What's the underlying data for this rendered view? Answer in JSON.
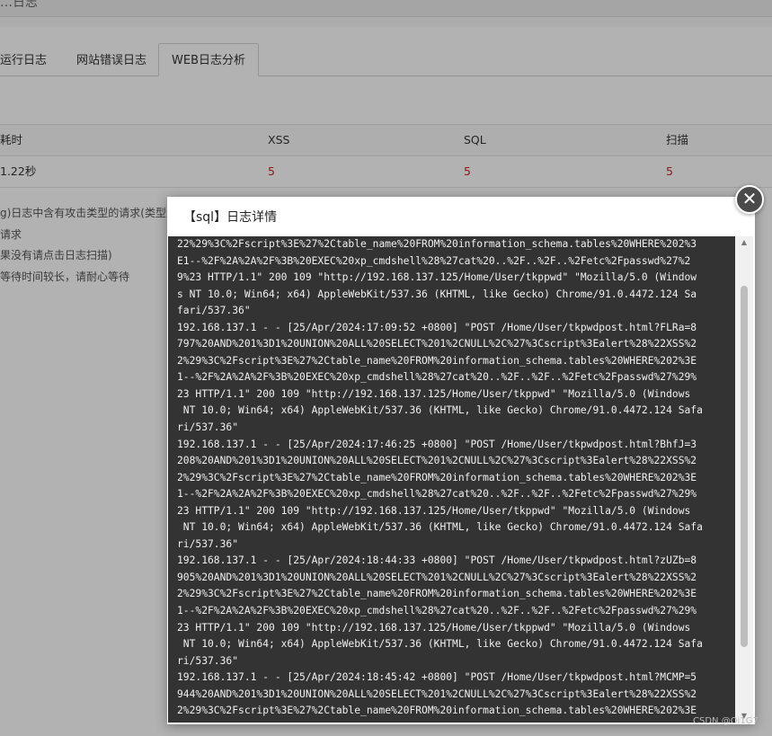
{
  "header": {
    "title_fragment": "…日志"
  },
  "tabs": [
    {
      "label": "运行日志"
    },
    {
      "label": "网站错误日志"
    },
    {
      "label": "WEB日志分析",
      "active": true
    }
  ],
  "table": {
    "columns": [
      "耗时",
      "XSS",
      "SQL",
      "扫描"
    ],
    "row": {
      "time": "1.22秒",
      "xss": "5",
      "sql": "5",
      "scan": "5"
    }
  },
  "tips": [
    "g)日志中含有攻击类型的请求(类型包",
    "请求",
    "果没有请点击日志扫描)",
    "等待时间较长，请耐心等待"
  ],
  "modal": {
    "title": "【sql】日志详情",
    "close_symbol": "✕",
    "log_lines": [
      "22%29%3C%2Fscript%3E%27%2Ctable_name%20FROM%20information_schema.tables%20WHERE%202%3",
      "E1--%2F%2A%2A%2F%3B%20EXEC%20xp_cmdshell%28%27cat%20..%2F..%2F..%2Fetc%2Fpasswd%27%2",
      "9%23 HTTP/1.1\" 200 109 \"http://192.168.137.125/Home/User/tkppwd\" \"Mozilla/5.0 (Window",
      "s NT 10.0; Win64; x64) AppleWebKit/537.36 (KHTML, like Gecko) Chrome/91.0.4472.124 Sa",
      "fari/537.36\"",
      "192.168.137.1 - - [25/Apr/2024:17:09:52 +0800] \"POST /Home/User/tkpwdpost.html?FLRa=8",
      "797%20AND%201%3D1%20UNION%20ALL%20SELECT%201%2CNULL%2C%27%3Cscript%3Ealert%28%22XSS%2",
      "2%29%3C%2Fscript%3E%27%2Ctable_name%20FROM%20information_schema.tables%20WHERE%202%3E",
      "1--%2F%2A%2A%2F%3B%20EXEC%20xp_cmdshell%28%27cat%20..%2F..%2F..%2Fetc%2Fpasswd%27%29%",
      "23 HTTP/1.1\" 200 109 \"http://192.168.137.125/Home/User/tkppwd\" \"Mozilla/5.0 (Windows",
      " NT 10.0; Win64; x64) AppleWebKit/537.36 (KHTML, like Gecko) Chrome/91.0.4472.124 Safa",
      "ri/537.36\"",
      "192.168.137.1 - - [25/Apr/2024:17:46:25 +0800] \"POST /Home/User/tkpwdpost.html?BhfJ=3",
      "208%20AND%201%3D1%20UNION%20ALL%20SELECT%201%2CNULL%2C%27%3Cscript%3Ealert%28%22XSS%2",
      "2%29%3C%2Fscript%3E%27%2Ctable_name%20FROM%20information_schema.tables%20WHERE%202%3E",
      "1--%2F%2A%2A%2F%3B%20EXEC%20xp_cmdshell%28%27cat%20..%2F..%2F..%2Fetc%2Fpasswd%27%29%",
      "23 HTTP/1.1\" 200 109 \"http://192.168.137.125/Home/User/tkppwd\" \"Mozilla/5.0 (Windows",
      " NT 10.0; Win64; x64) AppleWebKit/537.36 (KHTML, like Gecko) Chrome/91.0.4472.124 Safa",
      "ri/537.36\"",
      "192.168.137.1 - - [25/Apr/2024:18:44:33 +0800] \"POST /Home/User/tkpwdpost.html?zUZb=8",
      "905%20AND%201%3D1%20UNION%20ALL%20SELECT%201%2CNULL%2C%27%3Cscript%3Ealert%28%22XSS%2",
      "2%29%3C%2Fscript%3E%27%2Ctable_name%20FROM%20information_schema.tables%20WHERE%202%3E",
      "1--%2F%2A%2A%2F%3B%20EXEC%20xp_cmdshell%28%27cat%20..%2F..%2F..%2Fetc%2Fpasswd%27%29%",
      "23 HTTP/1.1\" 200 109 \"http://192.168.137.125/Home/User/tkppwd\" \"Mozilla/5.0 (Windows",
      " NT 10.0; Win64; x64) AppleWebKit/537.36 (KHTML, like Gecko) Chrome/91.0.4472.124 Safa",
      "ri/537.36\"",
      "192.168.137.1 - - [25/Apr/2024:18:45:42 +0800] \"POST /Home/User/tkpwdpost.html?MCMP=5",
      "944%20AND%201%3D1%20UNION%20ALL%20SELECT%201%2CNULL%2C%27%3Cscript%3Ealert%28%22XSS%2",
      "2%29%3C%2Fscript%3E%27%2Ctable_name%20FROM%20information_schema.tables%20WHERE%202%3E"
    ]
  },
  "watermark": "CSDN @Oi1G7",
  "colors": {
    "accent_red": "#cc2222",
    "log_bg": "#333333",
    "overlay": "rgba(0,0,0,0.30)"
  }
}
